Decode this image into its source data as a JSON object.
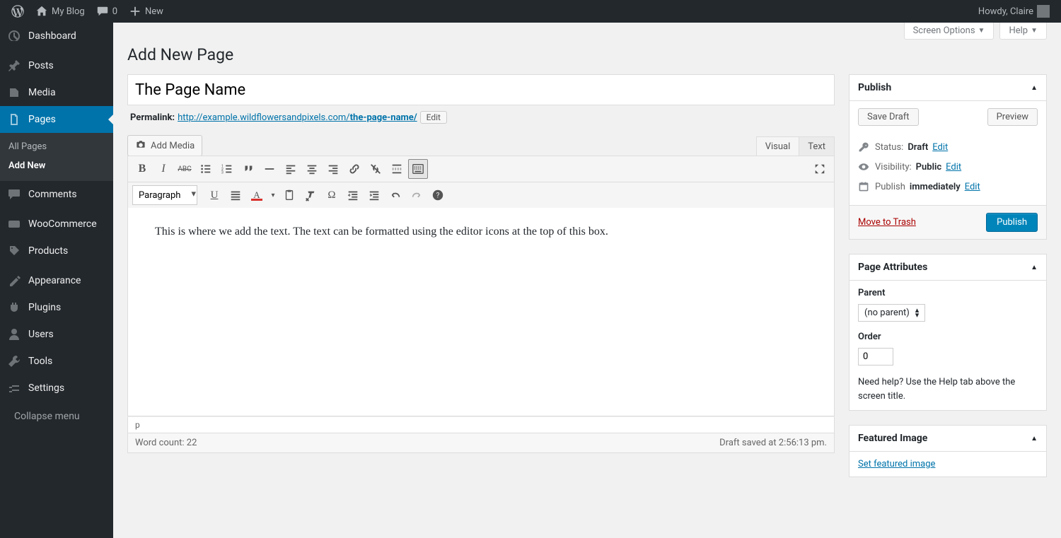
{
  "adminbar": {
    "site": "My Blog",
    "comments": "0",
    "new": "New",
    "howdy": "Howdy, Claire"
  },
  "sidebar": {
    "items": [
      {
        "label": "Dashboard"
      },
      {
        "label": "Posts"
      },
      {
        "label": "Media"
      },
      {
        "label": "Pages"
      },
      {
        "label": "Comments"
      },
      {
        "label": "WooCommerce"
      },
      {
        "label": "Products"
      },
      {
        "label": "Appearance"
      },
      {
        "label": "Plugins"
      },
      {
        "label": "Users"
      },
      {
        "label": "Tools"
      },
      {
        "label": "Settings"
      }
    ],
    "sub": {
      "all": "All Pages",
      "add": "Add New"
    },
    "collapse": "Collapse menu"
  },
  "screen": {
    "options": "Screen Options",
    "help": "Help"
  },
  "page": {
    "heading": "Add New Page",
    "title_value": "The Page Name",
    "permalink_label": "Permalink:",
    "permalink_base": "http://example.wildflowersandpixels.com/",
    "permalink_slug": "the-page-name/",
    "edit": "Edit",
    "add_media": "Add Media",
    "tab_visual": "Visual",
    "tab_text": "Text",
    "format": "Paragraph",
    "body": "This is where we add the text. The text can be formatted using the editor icons at the top of this box.",
    "path": "p",
    "wordcount": "Word count: 22",
    "saved": "Draft saved at 2:56:13 pm."
  },
  "publish": {
    "title": "Publish",
    "save_draft": "Save Draft",
    "preview": "Preview",
    "status_label": "Status:",
    "status_value": "Draft",
    "status_edit": "Edit",
    "vis_label": "Visibility:",
    "vis_value": "Public",
    "vis_edit": "Edit",
    "pub_label": "Publish",
    "pub_value": "immediately",
    "pub_edit": "Edit",
    "trash": "Move to Trash",
    "publish_btn": "Publish"
  },
  "attrs": {
    "title": "Page Attributes",
    "parent_label": "Parent",
    "parent_value": "(no parent)",
    "order_label": "Order",
    "order_value": "0",
    "help": "Need help? Use the Help tab above the screen title."
  },
  "featured": {
    "title": "Featured Image",
    "link": "Set featured image"
  }
}
